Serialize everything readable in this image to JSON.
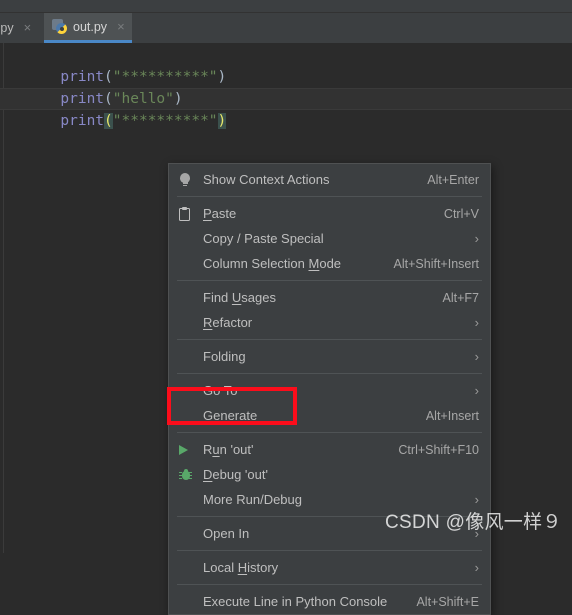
{
  "window": {
    "background": "#2b2b2b",
    "chrome_color": "#3c3f41"
  },
  "tabs": [
    {
      "label": "n.py",
      "active": false,
      "close_icon": "×",
      "icon": "python-file-icon"
    },
    {
      "label": "out.py",
      "active": true,
      "close_icon": "×",
      "icon": "python-file-icon"
    }
  ],
  "editor": {
    "lines": [
      {
        "fn": "print",
        "open": "(",
        "string": "\"**********\"",
        "close": ")"
      },
      {
        "fn": "print",
        "open": "(",
        "string": "\"hello\"",
        "close": ")"
      },
      {
        "fn": "print",
        "open": "(",
        "string": "\"**********\"",
        "close": ")"
      }
    ],
    "active_line_index": 2,
    "colors": {
      "function": "#8888c6",
      "string": "#6a8759",
      "paren": "#a9b7c6",
      "paren_highlight_bg": "#3b514d",
      "paren_highlight_fg": "#e8e86a",
      "active_line_bg": "#323232"
    }
  },
  "context_menu": {
    "items": [
      {
        "id": "show-context-actions",
        "label": "Show Context Actions",
        "mnemonic": "",
        "accel": "Alt+Enter",
        "icon": "lightbulb-icon",
        "submenu": false
      },
      {
        "separator": true
      },
      {
        "id": "paste",
        "label": "Paste",
        "mnemonic": "P",
        "accel": "Ctrl+V",
        "icon": "clipboard-icon",
        "submenu": false
      },
      {
        "id": "copy-paste-special",
        "label": "Copy / Paste Special",
        "mnemonic": "",
        "accel": "",
        "icon": "",
        "submenu": true
      },
      {
        "id": "column-selection-mode",
        "label": "Column Selection Mode",
        "mnemonic": "M",
        "accel": "Alt+Shift+Insert",
        "icon": "",
        "submenu": false
      },
      {
        "separator": true
      },
      {
        "id": "find-usages",
        "label": "Find Usages",
        "mnemonic": "U",
        "accel": "Alt+F7",
        "icon": "",
        "submenu": false
      },
      {
        "id": "refactor",
        "label": "Refactor",
        "mnemonic": "R",
        "accel": "",
        "icon": "",
        "submenu": true
      },
      {
        "separator": true
      },
      {
        "id": "folding",
        "label": "Folding",
        "mnemonic": "",
        "accel": "",
        "icon": "",
        "submenu": true
      },
      {
        "separator": true
      },
      {
        "id": "go-to",
        "label": "Go To",
        "mnemonic": "",
        "accel": "",
        "icon": "",
        "submenu": true
      },
      {
        "id": "generate",
        "label": "Generate",
        "mnemonic": "",
        "accel": "Alt+Insert",
        "icon": "",
        "submenu": false
      },
      {
        "separator": true
      },
      {
        "id": "run-out",
        "label": "Run 'out'",
        "mnemonic": "u",
        "accel": "Ctrl+Shift+F10",
        "icon": "run-play-icon",
        "submenu": false
      },
      {
        "id": "debug-out",
        "label": "Debug 'out'",
        "mnemonic": "D",
        "accel": "",
        "icon": "debug-bug-icon",
        "submenu": false
      },
      {
        "id": "more-run-debug",
        "label": "More Run/Debug",
        "mnemonic": "",
        "accel": "",
        "icon": "",
        "submenu": true
      },
      {
        "separator": true
      },
      {
        "id": "open-in",
        "label": "Open In",
        "mnemonic": "",
        "accel": "",
        "icon": "",
        "submenu": true
      },
      {
        "separator": true
      },
      {
        "id": "local-history",
        "label": "Local History",
        "mnemonic": "H",
        "accel": "",
        "icon": "",
        "submenu": true
      },
      {
        "separator": true
      },
      {
        "id": "execute-line-in-python-console",
        "label": "Execute Line in Python Console",
        "mnemonic": "",
        "accel": "Alt+Shift+E",
        "icon": "",
        "submenu": false
      }
    ],
    "submenu_arrow": "›"
  },
  "annotation": {
    "highlight_color": "#fc0d1b",
    "target": "run-out"
  },
  "watermark": {
    "text": "CSDN @像风一样９"
  }
}
